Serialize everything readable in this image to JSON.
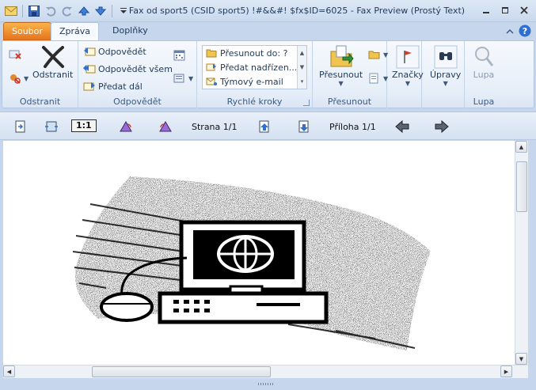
{
  "window": {
    "title": "Fax od sport5 (CSID sport5) !#&&#!  $fx$ID=6025  -  Fax Preview (Prostý Text)"
  },
  "tabs": {
    "file": "Soubor",
    "message": "Zpráva",
    "addins": "Doplňky"
  },
  "ribbon": {
    "delete_group": {
      "label": "Odstranit",
      "delete_button": "Odstranit"
    },
    "respond_group": {
      "label": "Odpovědět",
      "reply": "Odpovědět",
      "reply_all": "Odpovědět všem",
      "forward": "Předat dál"
    },
    "quick_steps_group": {
      "label": "Rychlé kroky",
      "items": [
        "Přesunout do: ?",
        "Předat nadřízen...",
        "Týmový e-mail"
      ]
    },
    "move_group": {
      "label": "Přesunout",
      "move_button": "Přesunout"
    },
    "tags_group": {
      "tags_button": "Značky"
    },
    "editing_group": {
      "edit_button": "Úpravy"
    },
    "zoom_group": {
      "label": "Lupa",
      "zoom_button": "Lupa"
    }
  },
  "preview_toolbar": {
    "actual_size": "1:1",
    "page_info": "Strana 1/1",
    "attachment_info": "Příloha 1/1"
  },
  "colors": {
    "file_tab": "#e8731c",
    "ribbon_bg": "#e6eef8",
    "frame": "#c6d6ec"
  }
}
